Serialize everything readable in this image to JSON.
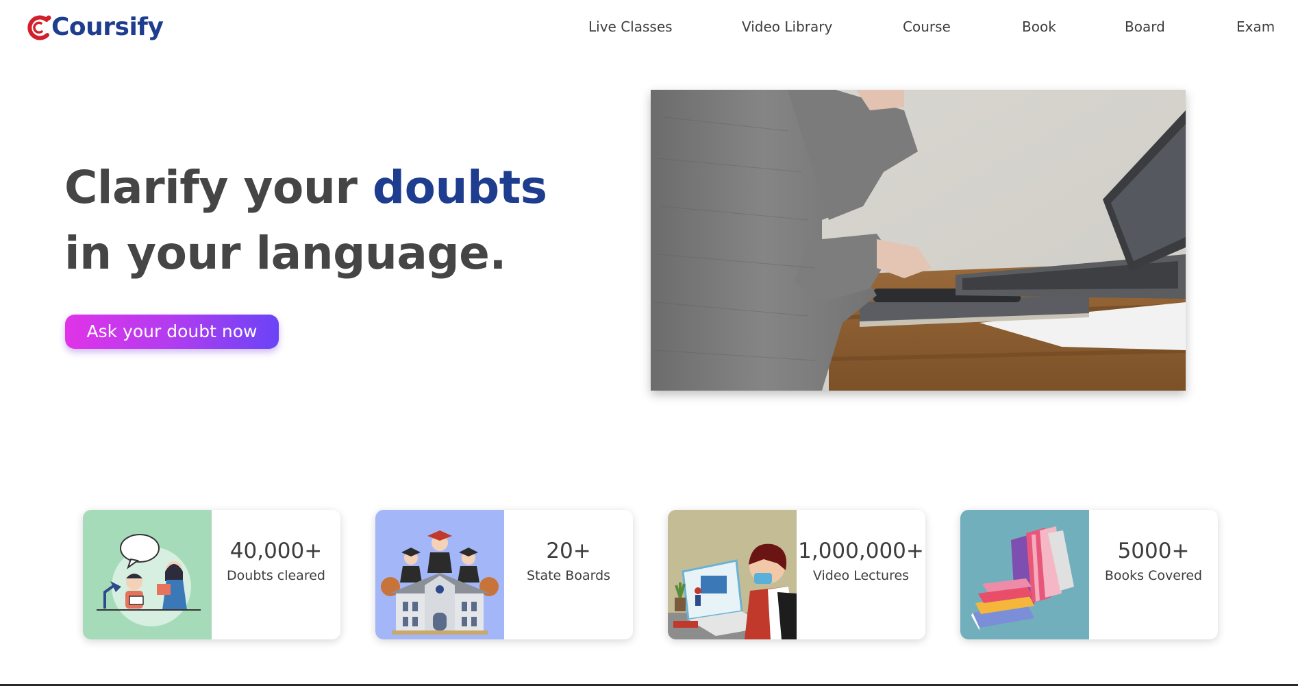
{
  "brand": {
    "name": "Coursify",
    "primary_color": "#1f3d8f",
    "logo_accent_color": "#d21f2c"
  },
  "nav": {
    "items": [
      {
        "label": "Live Classes"
      },
      {
        "label": "Video Library"
      },
      {
        "label": "Course"
      },
      {
        "label": "Book"
      },
      {
        "label": "Board"
      },
      {
        "label": "Exam"
      }
    ]
  },
  "hero": {
    "headline_part1": "Clarify your ",
    "headline_accent": "doubts",
    "headline_line2": "in your language.",
    "cta_label": "Ask your doubt now",
    "cta_gradient": [
      "#e033e8",
      "#6a44f6"
    ]
  },
  "stats": [
    {
      "value": "40,000+",
      "label": "Doubts cleared",
      "image_bg": "#a5dbb8"
    },
    {
      "value": "20+",
      "label": "State Boards",
      "image_bg": "#a3b7f8"
    },
    {
      "value": "1,000,000+",
      "label": "Video Lectures",
      "image_bg": "#c4bc95"
    },
    {
      "value": "5000+",
      "label": "Books Covered",
      "image_bg": "#72afbd"
    }
  ]
}
